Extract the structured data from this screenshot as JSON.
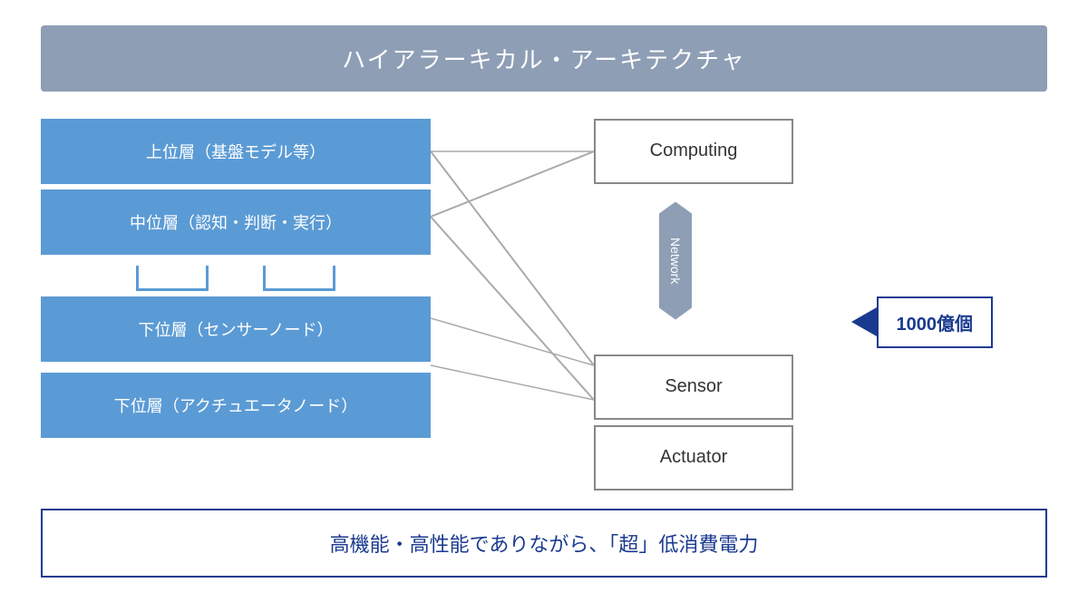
{
  "title": "ハイアラーキカル・アーキテクチャ",
  "layers": {
    "upper": "上位層（基盤モデル等）",
    "middle": "中位層（認知・判断・実行）",
    "lower_sensor": "下位層（センサーノード）",
    "lower_actuator": "下位層（アクチュエータノード）"
  },
  "right_boxes": {
    "computing": "Computing",
    "network": "Network",
    "sensor": "Sensor",
    "actuator": "Actuator"
  },
  "annotation": "1000億個",
  "bottom_text": "高機能・高性能でありながら、「超」低消費電力"
}
